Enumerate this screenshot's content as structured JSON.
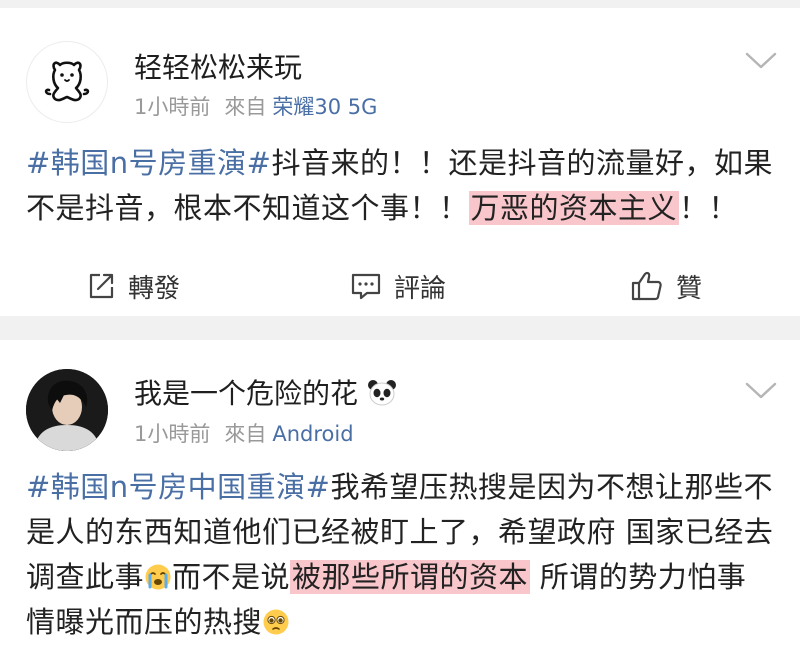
{
  "posts": [
    {
      "username": "轻轻松松来玩",
      "time": "1小時前",
      "via": "來自",
      "source": "荣耀30 5G",
      "content_segments": [
        {
          "text": "#韩国n号房重演#",
          "style": "topic"
        },
        {
          "text": "抖音来的！！还是抖音的流量好，如果不是抖音，根本不知道这个事！！",
          "style": "plain"
        },
        {
          "text": "万恶的资本主义",
          "style": "highlight"
        },
        {
          "text": "！！",
          "style": "plain"
        }
      ],
      "actions": {
        "repost": "轉發",
        "comment": "評論",
        "like": "贊"
      },
      "icons": {
        "avatar": "cartoon-bear-avatar",
        "menu": "chevron-down-icon",
        "repost": "repost-icon",
        "comment": "comment-icon",
        "like": "thumbs-up-icon"
      }
    },
    {
      "username": "我是一个危险的花",
      "username_emoji": "panda-emoji",
      "time": "1小時前",
      "via": "來自",
      "source": "Android",
      "content_segments": [
        {
          "text": "#韩国n号房中国重演#",
          "style": "topic"
        },
        {
          "text": "我希望压热搜是因为不想让那些不是人的东西知道他们已经被盯上了，希望政府 国家已经去调查此事",
          "style": "plain"
        },
        {
          "emoji": "crying-face-emoji"
        },
        {
          "text": "而不是说",
          "style": "plain"
        },
        {
          "text": "被那些所谓的资本",
          "style": "highlight"
        },
        {
          "text": " 所谓的势力怕事情曝光而压的热搜",
          "style": "plain"
        },
        {
          "emoji": "pleading-face-emoji"
        }
      ],
      "icons": {
        "avatar": "person-photo-avatar",
        "menu": "chevron-down-icon"
      }
    }
  ],
  "colors": {
    "topic": "#4a6fa5",
    "highlight": "#f9c7cb",
    "meta": "#999999",
    "background": "#f1f1f1"
  }
}
